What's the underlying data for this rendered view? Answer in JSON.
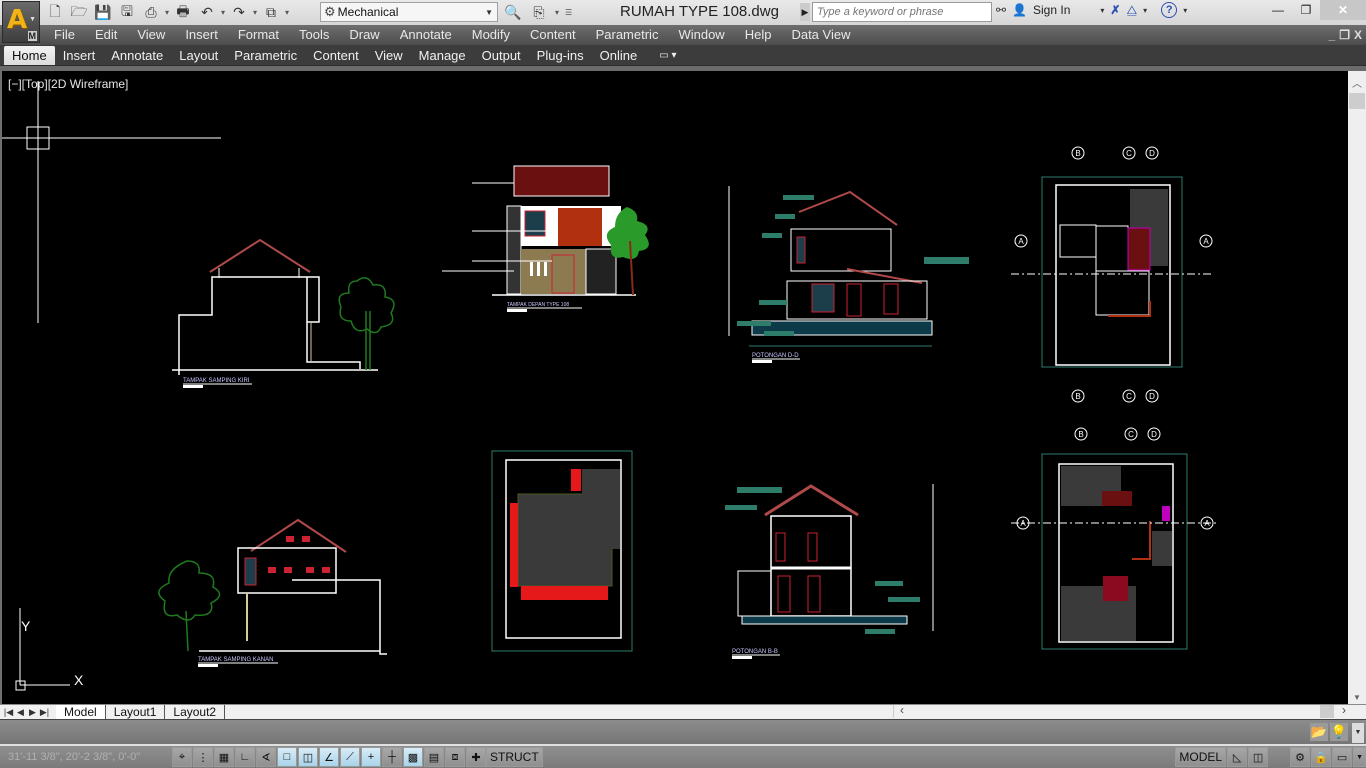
{
  "app": {
    "document_title": "RUMAH TYPE 108.dwg",
    "app_menu_badge": "M",
    "workspace": "Mechanical"
  },
  "search": {
    "placeholder": "Type a keyword or phrase",
    "sign_in_label": "Sign In"
  },
  "quick_access": [
    {
      "name": "new-icon",
      "glyph": "🗋"
    },
    {
      "name": "open-icon",
      "glyph": "🗁"
    },
    {
      "name": "save-icon",
      "glyph": "💾"
    },
    {
      "name": "save-as-icon",
      "glyph": "🖫"
    },
    {
      "name": "publish-icon",
      "glyph": "⎙"
    },
    {
      "name": "plot-icon",
      "glyph": "🖶"
    },
    {
      "name": "undo-icon",
      "glyph": "↶"
    },
    {
      "name": "redo-icon",
      "glyph": "↷"
    },
    {
      "name": "workspace-switch-icon",
      "glyph": "⧉"
    }
  ],
  "menubar": [
    "File",
    "Edit",
    "View",
    "Insert",
    "Format",
    "Tools",
    "Draw",
    "Annotate",
    "Modify",
    "Content",
    "Parametric",
    "Window",
    "Help",
    "Data View"
  ],
  "ribbon_tabs": [
    "Home",
    "Insert",
    "Annotate",
    "Layout",
    "Parametric",
    "Content",
    "View",
    "Manage",
    "Output",
    "Plug-ins",
    "Online"
  ],
  "active_ribbon_tab": "Home",
  "viewport": {
    "label": "[−][Top][2D Wireframe]",
    "ucs_x": "X",
    "ucs_y": "Y"
  },
  "drawings": [
    {
      "id": "tampak-samping-kiri",
      "title": "TAMPAK SAMPING KIRI"
    },
    {
      "id": "tampak-depan",
      "title": "TAMPAK DEPAN TYPE 108"
    },
    {
      "id": "potongan-d-d",
      "title": "POTONGAN D-D"
    },
    {
      "id": "denah-lantai-2",
      "title": ""
    },
    {
      "id": "tampak-samping-kanan",
      "title": "TAMPAK SAMPING KANAN"
    },
    {
      "id": "denah-atap",
      "title": ""
    },
    {
      "id": "potongan-b-b",
      "title": "POTONGAN B-B"
    },
    {
      "id": "denah-lantai-1",
      "title": ""
    }
  ],
  "grid_markers": {
    "top": [
      "B",
      "C",
      "D"
    ],
    "side": "A"
  },
  "layout_tabs": [
    "Model",
    "Layout1",
    "Layout2"
  ],
  "active_layout_tab": "Model",
  "status": {
    "coordinates": "31'-11 3/8\", 20'-2 3/8\", 0'-0\"",
    "struct_label": "STRUCT",
    "model_label": "MODEL",
    "toggles": [
      {
        "name": "infer-constraints-icon",
        "glyph": "⌖",
        "on": false
      },
      {
        "name": "snap-mode-icon",
        "glyph": "⋮",
        "on": false
      },
      {
        "name": "grid-display-icon",
        "glyph": "▦",
        "on": false
      },
      {
        "name": "ortho-mode-icon",
        "glyph": "∟",
        "on": false
      },
      {
        "name": "polar-tracking-icon",
        "glyph": "∢",
        "on": false
      },
      {
        "name": "object-snap-icon",
        "glyph": "□",
        "on": true
      },
      {
        "name": "3d-object-snap-icon",
        "glyph": "◫",
        "on": true
      },
      {
        "name": "object-snap-tracking-icon",
        "glyph": "∠",
        "on": true
      },
      {
        "name": "dynamic-ucs-icon",
        "glyph": "⟋",
        "on": true
      },
      {
        "name": "dynamic-input-icon",
        "glyph": "+",
        "on": true
      },
      {
        "name": "show-lineweight-icon",
        "glyph": "┼",
        "on": false
      },
      {
        "name": "transparency-icon",
        "glyph": "▩",
        "on": true
      },
      {
        "name": "quick-properties-icon",
        "glyph": "▤",
        "on": false
      },
      {
        "name": "selection-cycling-icon",
        "glyph": "⧈",
        "on": false
      },
      {
        "name": "annotation-monitor-icon",
        "glyph": "✚",
        "on": false
      }
    ]
  },
  "colors": {
    "canvas": "#000000",
    "linework": "#ffffff",
    "roof": "#b04a4a",
    "dimension": "#2e7d6b",
    "tree": "#1f7a1f",
    "brick": "#8b1a1a",
    "highlight_red": "#e51919",
    "magenta": "#c000c0"
  }
}
